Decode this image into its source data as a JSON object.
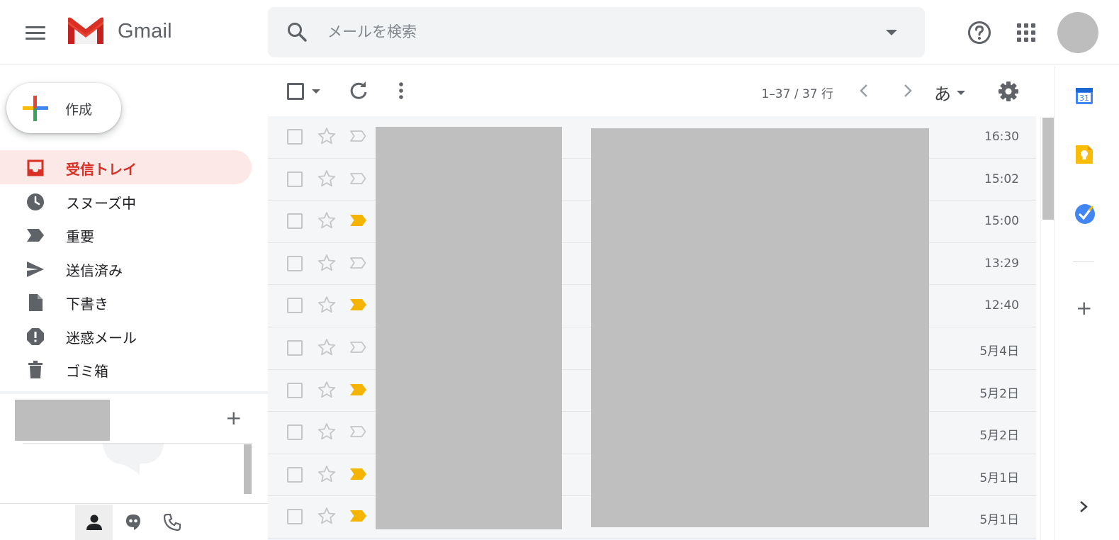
{
  "app": {
    "name": "Gmail"
  },
  "search": {
    "placeholder": "メールを検索"
  },
  "compose": {
    "label": "作成"
  },
  "sidebar": {
    "items": [
      {
        "label": "受信トレイ",
        "icon": "inbox-icon",
        "active": true
      },
      {
        "label": "スヌーズ中",
        "icon": "clock-icon"
      },
      {
        "label": "重要",
        "icon": "important-label-icon"
      },
      {
        "label": "送信済み",
        "icon": "send-icon"
      },
      {
        "label": "下書き",
        "icon": "draft-file-icon"
      },
      {
        "label": "迷惑メール",
        "icon": "spam-icon"
      },
      {
        "label": "ゴミ箱",
        "icon": "trash-icon"
      }
    ]
  },
  "toolbar": {
    "page_count": "1–37 / 37 行",
    "ime_label": "あ"
  },
  "mail_rows": [
    {
      "time": "16:30",
      "important": false
    },
    {
      "time": "15:02",
      "important": false
    },
    {
      "time": "15:00",
      "important": true
    },
    {
      "time": "13:29",
      "important": false
    },
    {
      "time": "12:40",
      "important": true
    },
    {
      "time": "5月4日",
      "important": false
    },
    {
      "time": "5月2日",
      "important": true
    },
    {
      "time": "5月2日",
      "important": false
    },
    {
      "time": "5月1日",
      "important": true
    },
    {
      "time": "5月1日",
      "important": true
    }
  ],
  "side_panel": {
    "calendar_day": "31"
  },
  "colors": {
    "active_bg": "#fce8e6",
    "active_text": "#d93025",
    "important_marker": "#f4b400",
    "calendar_blue": "#4285f4",
    "keep_yellow": "#fbbc04"
  }
}
